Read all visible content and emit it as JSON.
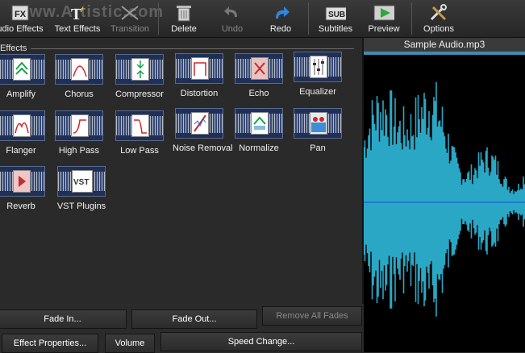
{
  "toolbar": {
    "buttons": [
      {
        "label": "udio Effects",
        "icon": "fx-icon",
        "disabled": false
      },
      {
        "label": "Text Effects",
        "icon": "text-t-icon",
        "disabled": false
      },
      {
        "label": "Transition",
        "icon": "transition-icon",
        "disabled": true
      },
      {
        "label": "Delete",
        "icon": "trash-icon",
        "disabled": false
      },
      {
        "label": "Undo",
        "icon": "undo-icon",
        "disabled": true
      },
      {
        "label": "Redo",
        "icon": "redo-icon",
        "disabled": false
      },
      {
        "label": "Subtitles",
        "icon": "sub-icon",
        "disabled": false,
        "badge": "SUB"
      },
      {
        "label": "Preview",
        "icon": "play-icon",
        "disabled": false
      },
      {
        "label": "Options",
        "icon": "tools-icon",
        "disabled": false
      }
    ],
    "watermark": "www.Artistic.com"
  },
  "effects_panel": {
    "group_label": "Effects",
    "items": [
      {
        "label": "Amplify"
      },
      {
        "label": "Chorus"
      },
      {
        "label": "Compressor"
      },
      {
        "label": "Distortion"
      },
      {
        "label": "Echo"
      },
      {
        "label": "Equalizer"
      },
      {
        "label": "Flanger"
      },
      {
        "label": "High Pass"
      },
      {
        "label": "Low Pass"
      },
      {
        "label": "Noise Removal"
      },
      {
        "label": "Normalize"
      },
      {
        "label": "Pan"
      },
      {
        "label": "Reverb"
      },
      {
        "label": "VST Plugins"
      }
    ]
  },
  "bottom_buttons": {
    "fade_in": "Fade In...",
    "fade_out": "Fade Out...",
    "remove_all_fades": "Remove All Fades",
    "effect_properties": "Effect Properties...",
    "volume": "Volume",
    "speed_change": "Speed Change..."
  },
  "audio_panel": {
    "title": "Sample Audio.mp3",
    "colors": {
      "waveform": "#2aa7c4",
      "center_line": "#1d6bd6",
      "background": "#000000"
    }
  }
}
